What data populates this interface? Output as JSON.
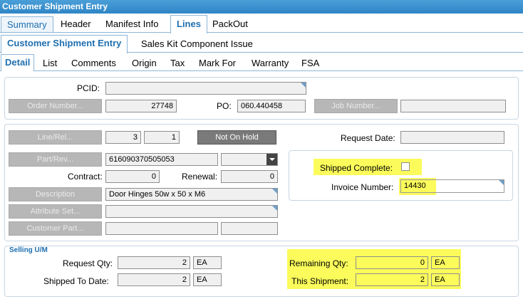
{
  "window": {
    "title": "Customer Shipment Entry"
  },
  "top_tabs": [
    {
      "label": "Summary"
    },
    {
      "label": "Header"
    },
    {
      "label": "Manifest Info"
    },
    {
      "label": "Lines"
    },
    {
      "label": "PackOut"
    }
  ],
  "sub_tabs": [
    {
      "label": "Customer Shipment Entry"
    },
    {
      "label": "Sales Kit Component Issue"
    }
  ],
  "detail_tabs": [
    {
      "label": "Detail"
    },
    {
      "label": "List"
    },
    {
      "label": "Comments"
    },
    {
      "label": "Origin"
    },
    {
      "label": "Tax"
    },
    {
      "label": "Mark For"
    },
    {
      "label": "Warranty"
    },
    {
      "label": "FSA"
    }
  ],
  "header_panel": {
    "pcid_label": "PCID:",
    "pcid_value": "",
    "order_button": "Order Number...",
    "order_value": "27748",
    "po_label": "PO:",
    "po_value": "060.440458",
    "job_button": "Job Number...",
    "job_value": ""
  },
  "line_panel": {
    "line_button": "Line/Rel...",
    "line_value": "3",
    "rel_value": "1",
    "hold_button": "Not On Hold",
    "part_button": "Part/Rev...",
    "part_value": "616090370505053",
    "rev_value": "",
    "contract_label": "Contract:",
    "contract_value": "0",
    "renewal_label": "Renewal:",
    "renewal_value": "0",
    "description_button": "Description",
    "description_value": "Door Hinges 50w x 50 x M6",
    "attribute_button": "Attribute Set...",
    "attribute_value": "",
    "customer_part_button": "Customer Part...",
    "customer_part_value": "",
    "customer_part_rev": "",
    "request_date_label": "Request Date:",
    "request_date_value": "",
    "shipped_complete_label": "Shipped Complete:",
    "shipped_complete_checked": false,
    "invoice_label": "Invoice Number:",
    "invoice_value": "14430"
  },
  "selling_um": {
    "title": "Selling U/M",
    "request_qty_label": "Request Qty:",
    "request_qty_value": "2",
    "request_qty_um": "EA",
    "shipped_to_date_label": "Shipped To Date:",
    "shipped_to_date_value": "2",
    "shipped_to_date_um": "EA",
    "remaining_qty_label": "Remaining Qty:",
    "remaining_qty_value": "0",
    "remaining_qty_um": "EA",
    "this_shipment_label": "This Shipment:",
    "this_shipment_value": "2",
    "this_shipment_um": "EA"
  },
  "colors": {
    "title_bar": "#2f86c6",
    "tab_accent": "#1e6fb0",
    "highlight": "#fbfb5b",
    "disabled_button": "#b7b7b7",
    "hold_button": "#7a7a7a"
  }
}
